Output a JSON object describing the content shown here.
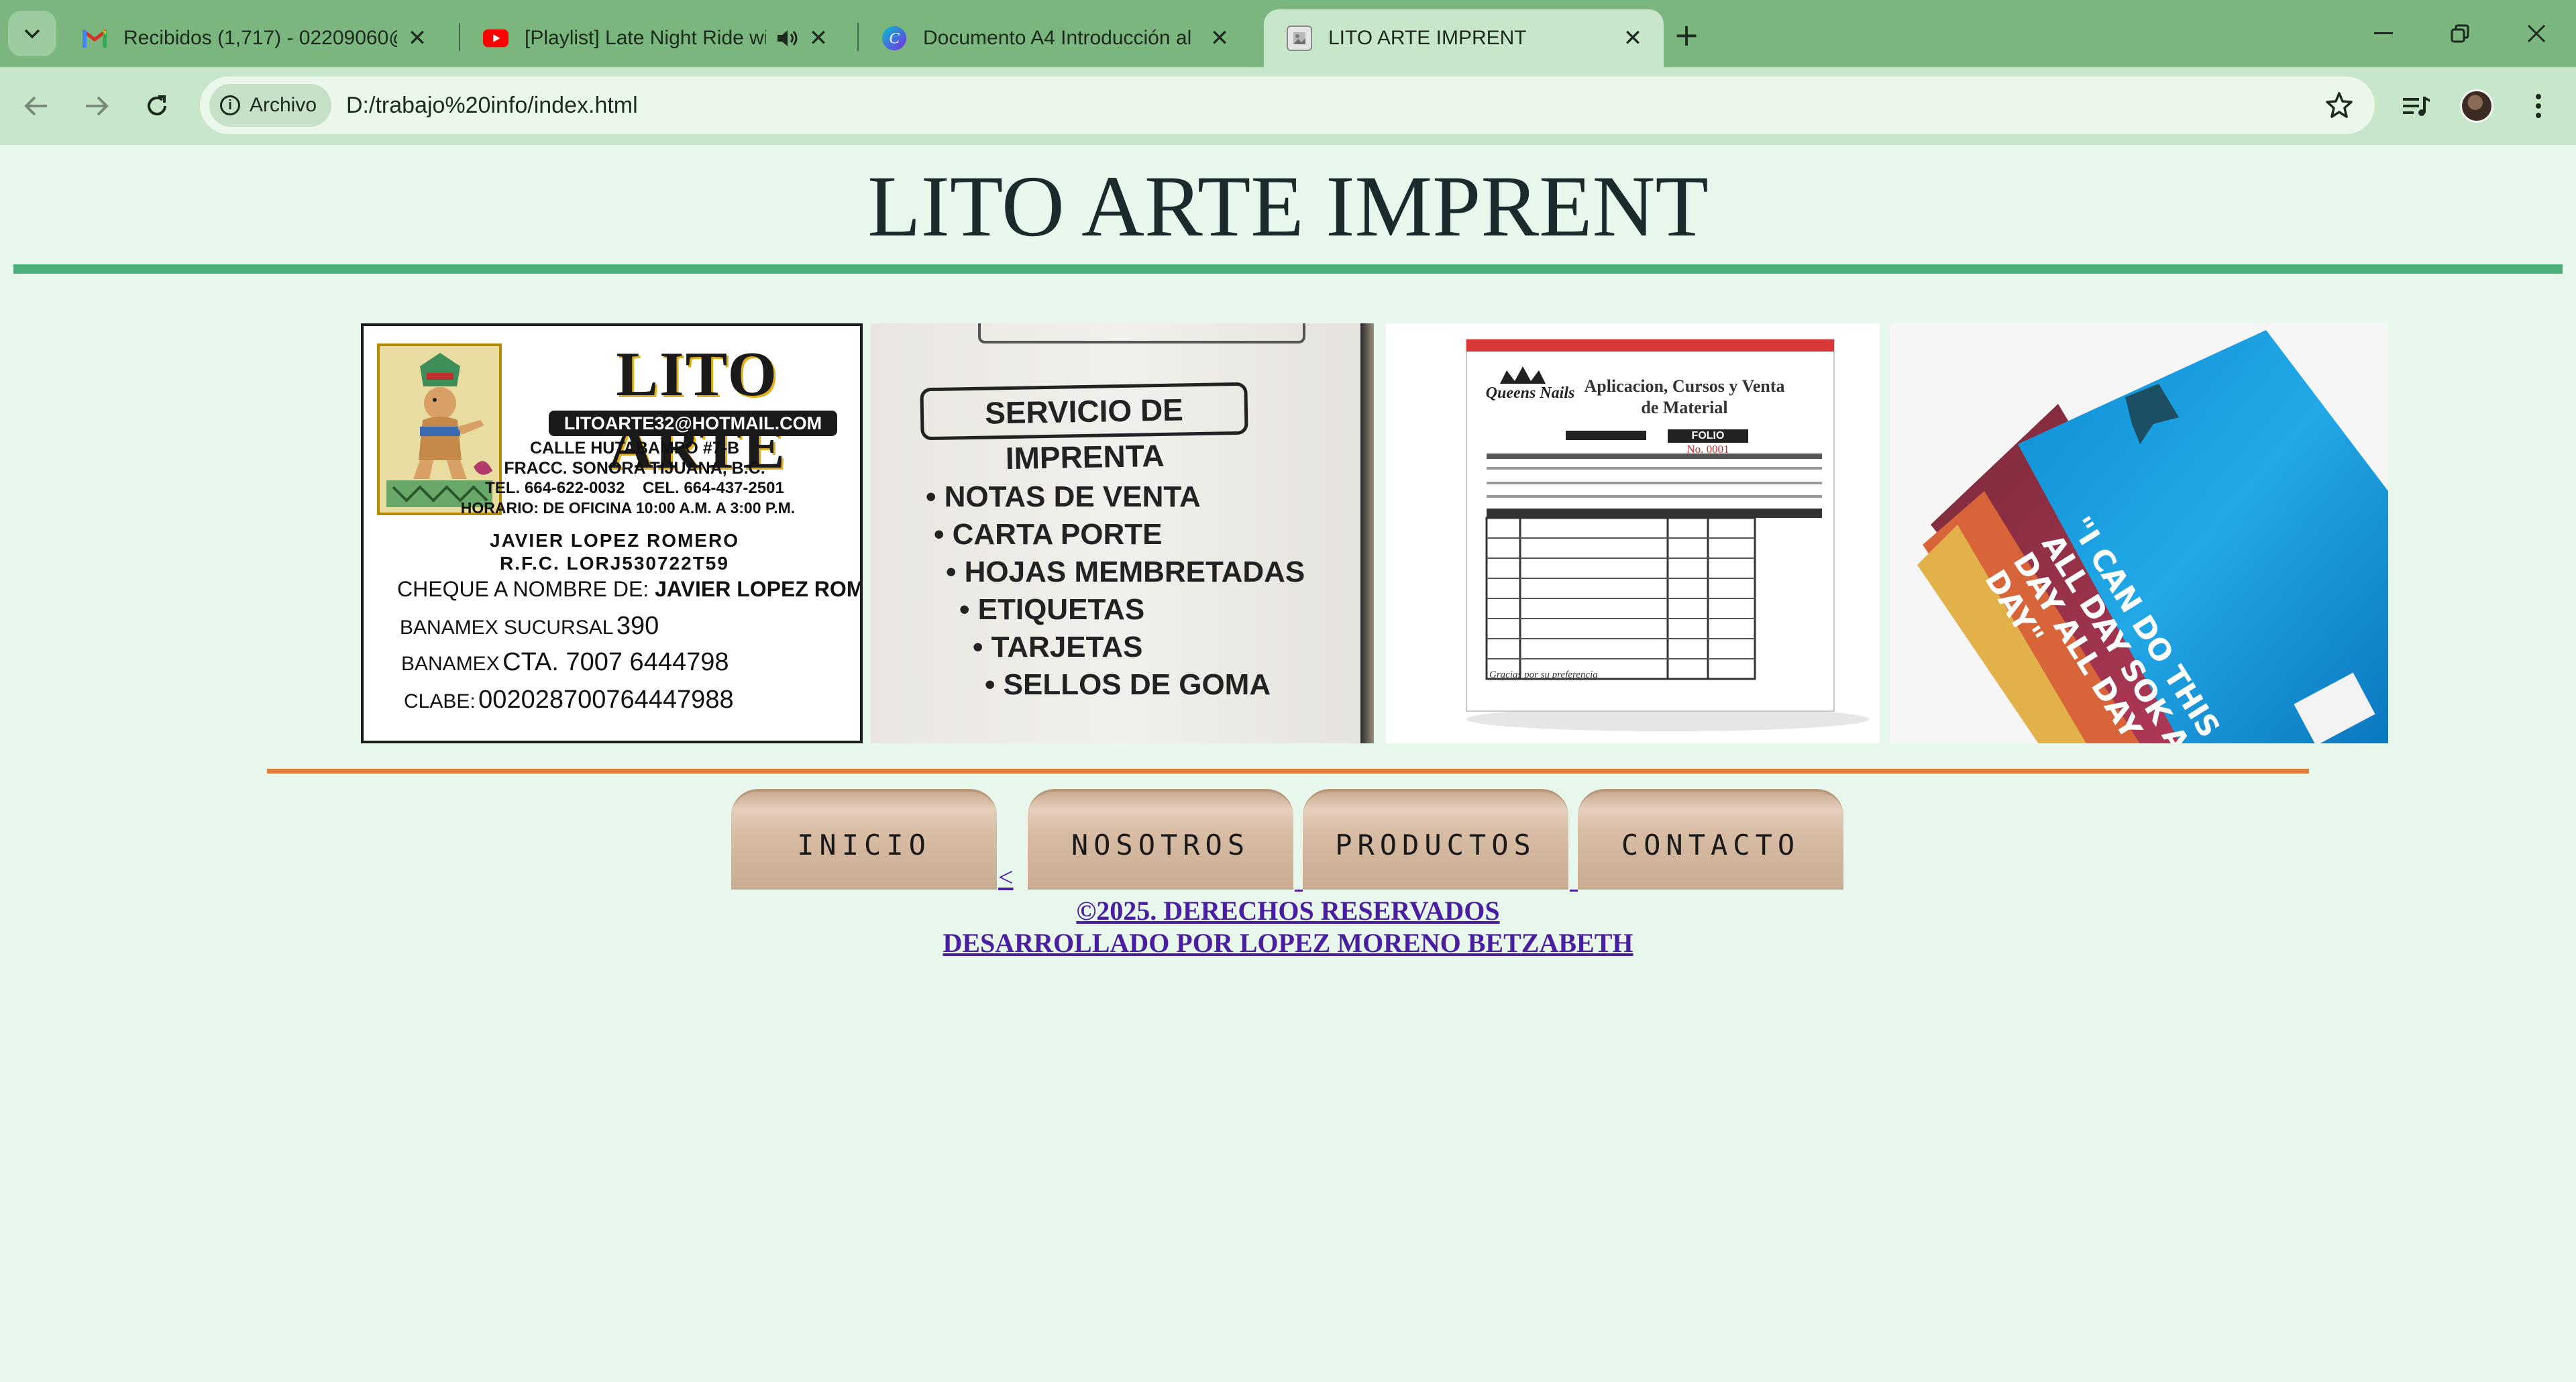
{
  "browser": {
    "tabs": [
      {
        "title": "Recibidos (1,717) - 02209060@",
        "icon": "gmail-icon"
      },
      {
        "title": "[Playlist] Late Night Ride wi",
        "icon": "youtube-icon"
      },
      {
        "title": "Documento A4 Introducción al",
        "icon": "canva-icon"
      },
      {
        "title": "LITO ARTE IMPRENT",
        "icon": "page-icon",
        "active": true
      }
    ],
    "site_info_label": "Archivo",
    "url": "D:/trabajo%20info/index.html"
  },
  "page": {
    "title": "LITO ARTE IMPRENT",
    "card": {
      "brand": "LITO ARTE",
      "email": "LITOARTE32@HOTMAIL.COM",
      "address1": "CALLE HUTABAMPO #7-B",
      "address2": "FRACC. SONORA TIJUANA, B.C.",
      "phones": "TEL. 664-622-0032    CEL. 664-437-2501",
      "hours": "HORARIO: DE OFICINA 10:00 A.M. A 3:00 P.M.",
      "name": "JAVIER LOPEZ ROMERO",
      "rfc": "R.F.C. LORJ530722T59",
      "cheque_label": "CHEQUE A NOMBRE DE:",
      "cheque_name": "JAVIER LOPEZ ROMERO",
      "branch_label": "BANAMEX SUCURSAL",
      "branch": "390",
      "account_label": "BANAMEX",
      "account": "CTA. 7007 6444798",
      "clabe_label": "CLABE:",
      "clabe": "002028700764447988"
    },
    "servicio": {
      "heading": "SERVICIO DE IMPRENTA",
      "items": [
        "• NOTAS DE VENTA",
        "• CARTA PORTE",
        "• HOJAS MEMBRETADAS",
        "• ETIQUETAS",
        "• TARJETAS",
        "• SELLOS DE GOMA"
      ]
    },
    "nota": {
      "brand": "Queens Nails",
      "heading": "Aplicacion, Cursos y Venta de Material",
      "folio_label": "FOLIO",
      "folio_no": "No. 0001",
      "footer": "Gracias por su preferencia"
    },
    "flyer": {
      "text": "\"I CAN DO THIS ALL DAY SOK ALL DAY ALL DAY ALL DAY\""
    },
    "nav": [
      "INICIO",
      "NOSOTROS",
      "PRODUCTOS",
      "CONTACTO"
    ],
    "nav_stray": "<",
    "footer": {
      "line1": "©2025. DERECHOS RESERVADOS",
      "line2": "DESARROLLADO POR LOPEZ MORENO BETZABETH"
    },
    "colors": {
      "page_bg": "#e8f7ec",
      "green_rule": "#4caf7a",
      "orange_rule": "#e07a3a",
      "link": "#4a1ea0"
    }
  }
}
